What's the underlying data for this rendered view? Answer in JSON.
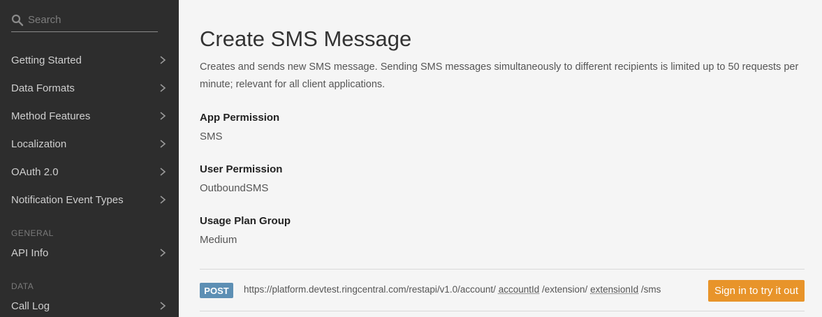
{
  "sidebar": {
    "search_placeholder": "Search",
    "items": [
      {
        "label": "Getting Started"
      },
      {
        "label": "Data Formats"
      },
      {
        "label": "Method Features"
      },
      {
        "label": "Localization"
      },
      {
        "label": "OAuth 2.0"
      },
      {
        "label": "Notification Event Types"
      }
    ],
    "section_general": "GENERAL",
    "general_items": [
      {
        "label": "API Info"
      }
    ],
    "section_data": "DATA",
    "data_items": [
      {
        "label": "Call Log"
      }
    ]
  },
  "main": {
    "title": "Create SMS Message",
    "description": "Creates and sends new SMS message. Sending SMS messages simultaneously to different recipients is limited up to 50 requests per minute; relevant for all client applications.",
    "app_permission_label": "App Permission",
    "app_permission_value": "SMS",
    "user_permission_label": "User Permission",
    "user_permission_value": "OutboundSMS",
    "usage_plan_label": "Usage Plan Group",
    "usage_plan_value": "Medium",
    "endpoint": {
      "method": "POST",
      "prefix": "https://platform.devtest.ringcentral.com/restapi/v1.0/account/",
      "param1": "accountId",
      "mid": "/extension/",
      "param2": "extensionId",
      "suffix": "/sms"
    },
    "try_button": "Sign in to try it out"
  },
  "colors": {
    "sidebar_bg": "#2d2d2d",
    "method_badge": "#5d8fb4",
    "accent_button": "#e8942a"
  }
}
